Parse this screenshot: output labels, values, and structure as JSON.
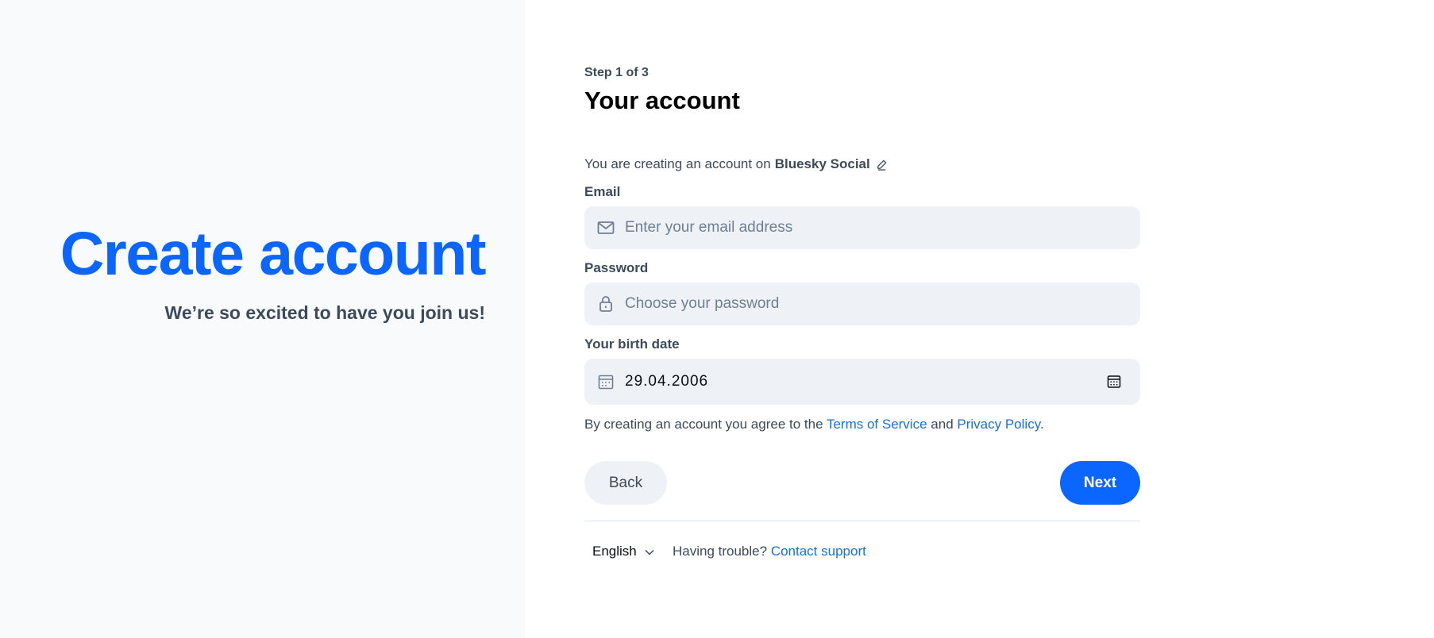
{
  "hero": {
    "title": "Create account",
    "subtitle": "We’re so excited to have you join us!"
  },
  "form": {
    "step": "Step 1 of 3",
    "title": "Your account",
    "server_prefix": "You are creating an account on",
    "server_name": "Bluesky Social",
    "email": {
      "label": "Email",
      "placeholder": "Enter your email address",
      "value": "",
      "icon": "envelope-icon"
    },
    "password": {
      "label": "Password",
      "placeholder": "Choose your password",
      "value": "",
      "icon": "lock-icon"
    },
    "birthdate": {
      "label": "Your birth date",
      "value": "29.04.2006",
      "icon": "calendar-icon"
    },
    "terms": {
      "prefix": "By creating an account you agree to the",
      "tos": "Terms of Service",
      "and": "and",
      "privacy": "Privacy Policy",
      "suffix": "."
    },
    "back_label": "Back",
    "next_label": "Next"
  },
  "footer": {
    "language": "English",
    "trouble": "Having trouble?",
    "support_link": "Contact support"
  },
  "colors": {
    "brand": "#0a66ff",
    "link": "#1a6fd8",
    "muted_text": "#3c4a5c",
    "field_bg": "#eef2f6",
    "left_bg": "#f8fafc"
  }
}
